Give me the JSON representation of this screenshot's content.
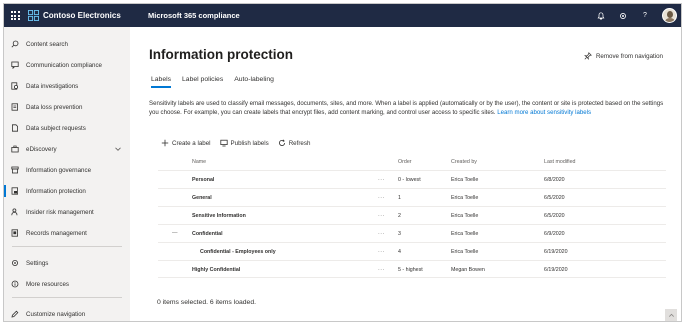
{
  "topbar": {
    "brand_name": "Contoso Electronics",
    "app_name": "Microsoft 365 compliance",
    "bell_icon": "bell-icon",
    "settings_icon": "gear-icon",
    "help_label": "?"
  },
  "sidebar": {
    "items": [
      {
        "label": "Content search",
        "icon": "search-icon"
      },
      {
        "label": "Communication compliance",
        "icon": "chat-icon"
      },
      {
        "label": "Data investigations",
        "icon": "investigation-icon"
      },
      {
        "label": "Data loss prevention",
        "icon": "shield-doc-icon"
      },
      {
        "label": "Data subject requests",
        "icon": "document-icon"
      },
      {
        "label": "eDiscovery",
        "icon": "briefcase-icon"
      },
      {
        "label": "Information governance",
        "icon": "archive-icon"
      },
      {
        "label": "Information protection",
        "icon": "lock-doc-icon"
      },
      {
        "label": "Insider risk management",
        "icon": "person-icon"
      },
      {
        "label": "Records management",
        "icon": "records-icon"
      },
      {
        "label": "Settings",
        "icon": "gear-icon"
      },
      {
        "label": "More resources",
        "icon": "info-icon"
      },
      {
        "label": "Customize navigation",
        "icon": "pencil-icon"
      }
    ],
    "active_index": 7
  },
  "main": {
    "title": "Information protection",
    "remove_nav_label": "Remove from navigation",
    "tabs": [
      {
        "label": "Labels",
        "active": true
      },
      {
        "label": "Label policies",
        "active": false
      },
      {
        "label": "Auto-labeling",
        "active": false
      }
    ],
    "description": "Sensitivity labels are used to classify email messages, documents, sites, and more. When a label is applied (automatically or by the user), the content or site is protected based on the settings you choose. For example, you can create labels that encrypt files, add content marking, and control user access to specific sites.",
    "learn_more": "Learn more about sensitivity labels",
    "toolbar": {
      "create_label": "Create a label",
      "publish_labels": "Publish labels",
      "refresh": "Refresh"
    },
    "table": {
      "columns": [
        "Name",
        "Order",
        "Created by",
        "Last modified"
      ],
      "rows": [
        {
          "name": "Personal",
          "order": "0 - lowest",
          "created_by": "Erica Toelle",
          "modified": "6/8/2020",
          "level": 0
        },
        {
          "name": "General",
          "order": "1",
          "created_by": "Erica Toelle",
          "modified": "6/5/2020",
          "level": 0
        },
        {
          "name": "Sensitive Information",
          "order": "2",
          "created_by": "Erica Toelle",
          "modified": "6/5/2020",
          "level": 0
        },
        {
          "name": "Confidential",
          "order": "3",
          "created_by": "Erica Toelle",
          "modified": "6/9/2020",
          "level": 0,
          "expandable": true
        },
        {
          "name": "Confidential - Employees only",
          "order": "4",
          "created_by": "Erica Toelle",
          "modified": "6/19/2020",
          "level": 1
        },
        {
          "name": "Highly Confidential",
          "order": "5 - highest",
          "created_by": "Megan Bowen",
          "modified": "6/19/2020",
          "level": 0
        }
      ],
      "row_menu": "···"
    },
    "status": "0 items selected.  6 items loaded."
  },
  "colors": {
    "topbar": "#1f2a44",
    "sidebar": "#f3f2f1",
    "accent": "#0078d4"
  }
}
